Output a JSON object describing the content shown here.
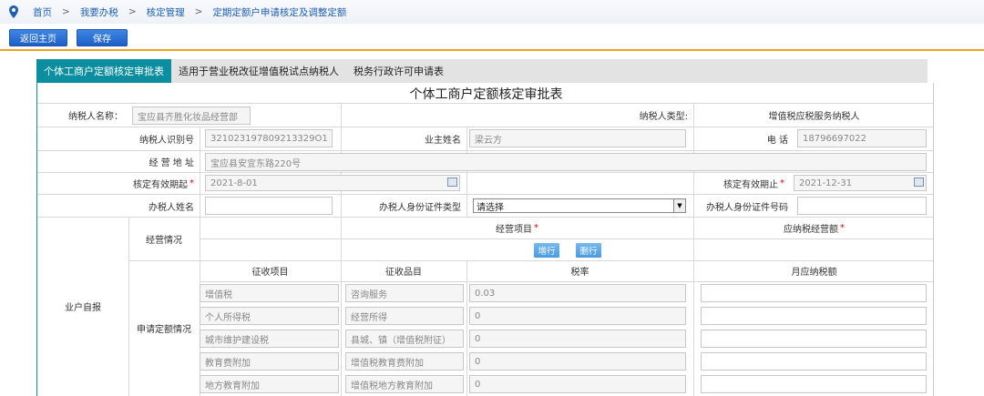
{
  "breadcrumb": {
    "items": [
      "首页",
      "我要办税",
      "核定管理",
      "定期定额户申请核定及调整定额"
    ],
    "separator": ">"
  },
  "toolbar": {
    "home_label": "返回主页",
    "save_label": "保存"
  },
  "tabs": [
    "个体工商户定额核定审批表",
    "适用于营业税改征增值税试点纳税人",
    "税务行政许可申请表"
  ],
  "form": {
    "title": "个体工商户定额核定审批表",
    "taxpayer_name_label": "纳税人名称：",
    "taxpayer_name": "宝应县齐胜化妆品经营部",
    "taxpayer_type_label": "纳税人类型:",
    "taxpayer_type": "增值税应税服务纳税人",
    "tax_id_label": "纳税人识别号",
    "tax_id": "321023197809213329O1",
    "owner_label": "业主姓名",
    "owner": "梁云方",
    "phone_label": "电 话",
    "phone": "18796697022",
    "address_label": "经 营 地 址",
    "address": "宝应县安宜东路220号",
    "start_label": "核定有效期起",
    "start": "2021-8-01",
    "end_label": "核定有效期止",
    "end": "2021-12-31",
    "agent_label": "办税人姓名",
    "id_type_label": "办税人身份证件类型",
    "id_type": "请选择",
    "id_no_label": "办税人身份证件号码",
    "self_report_label": "业户自报",
    "business_label": "经营情况",
    "business_item_label": "经营项目",
    "taxable_amount_label": "应纳税经营额",
    "add_row": "增行",
    "del_row": "删行",
    "apply_label": "申请定额情况",
    "headers": [
      "征收项目",
      "征收品目",
      "税率",
      "月应纳税额"
    ],
    "rows": [
      {
        "item": "增值税",
        "sub": "咨询服务",
        "rate": "0.03"
      },
      {
        "item": "个人所得税",
        "sub": "经营所得",
        "rate": "0"
      },
      {
        "item": "城市维护建设税",
        "sub": "县城、镇（增值税附征）",
        "rate": "0"
      },
      {
        "item": "教育费附加",
        "sub": "增值税教育费附加",
        "rate": "0"
      },
      {
        "item": "地方教育附加",
        "sub": "增值税地方教育附加",
        "rate": "0"
      }
    ]
  },
  "colors": {
    "accent": "#0b8fa0",
    "button": "#2a6fd6",
    "divider": "#f0a21c"
  }
}
